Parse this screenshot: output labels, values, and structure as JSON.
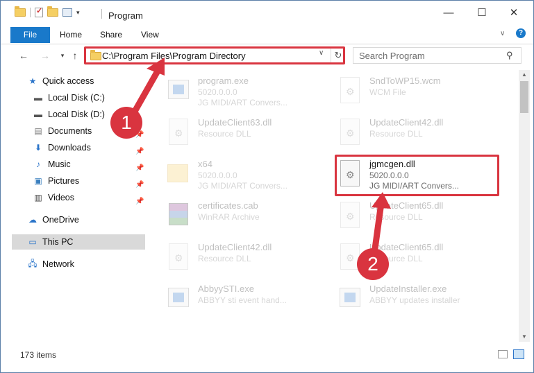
{
  "window": {
    "title": "Program"
  },
  "ribbon": {
    "tabs": [
      "File",
      "Home",
      "Share",
      "View"
    ]
  },
  "address": {
    "path": "C:\\Program Files\\Program Directory"
  },
  "search": {
    "placeholder": "Search Program"
  },
  "sidebar": {
    "items": [
      {
        "label": "Quick access",
        "icon": "star-icon"
      },
      {
        "label": "Local Disk (C:)",
        "icon": "drive-icon"
      },
      {
        "label": "Local Disk (D:)",
        "icon": "drive-icon"
      },
      {
        "label": "Documents",
        "icon": "documents-icon"
      },
      {
        "label": "Downloads",
        "icon": "download-icon"
      },
      {
        "label": "Music",
        "icon": "music-icon"
      },
      {
        "label": "Pictures",
        "icon": "pictures-icon"
      },
      {
        "label": "Videos",
        "icon": "videos-icon"
      },
      {
        "label": "OneDrive",
        "icon": "cloud-icon"
      },
      {
        "label": "This PC",
        "icon": "computer-icon"
      },
      {
        "label": "Network",
        "icon": "network-icon"
      }
    ]
  },
  "files": [
    {
      "name": "program.exe",
      "line2": "5020.0.0.0",
      "line3": "JG MIDI/ART Convers...",
      "icon": "exe"
    },
    {
      "name": "SndToWP15.wcm",
      "line2": "WCM File",
      "line3": "",
      "icon": "doc"
    },
    {
      "name": "UpdateClient63.dll",
      "line2": "Resource DLL",
      "line3": "",
      "icon": "dll"
    },
    {
      "name": "UpdateClient42.dll",
      "line2": "Resource DLL",
      "line3": "",
      "icon": "dll"
    },
    {
      "name": "x64",
      "line2": "5020.0.0.0",
      "line3": "JG MIDI/ART Convers...",
      "icon": "folder"
    },
    {
      "name": "jgmcgen.dll",
      "line2": "5020.0.0.0",
      "line3": "JG MIDI/ART Convers...",
      "icon": "dll"
    },
    {
      "name": "certificates.cab",
      "line2": "WinRAR Archive",
      "line3": "",
      "icon": "winrar"
    },
    {
      "name": "UpdateClient65.dll",
      "line2": "Resource DLL",
      "line3": "",
      "icon": "dll"
    },
    {
      "name": "UpdateClient42.dll",
      "line2": "Resource DLL",
      "line3": "",
      "icon": "dll"
    },
    {
      "name": "UpdateClient65.dll",
      "line2": "Resource DLL",
      "line3": "",
      "icon": "dll"
    },
    {
      "name": "AbbyySTI.exe",
      "line2": "ABBYY sti event hand...",
      "line3": "",
      "icon": "exe"
    },
    {
      "name": "UpdateInstaller.exe",
      "line2": "ABBYY updates installer",
      "line3": "",
      "icon": "exe"
    }
  ],
  "status": {
    "item_count": "173 items"
  },
  "callouts": [
    "1",
    "2"
  ],
  "colors": {
    "accent": "#1979ca",
    "highlight": "#d9343f"
  }
}
